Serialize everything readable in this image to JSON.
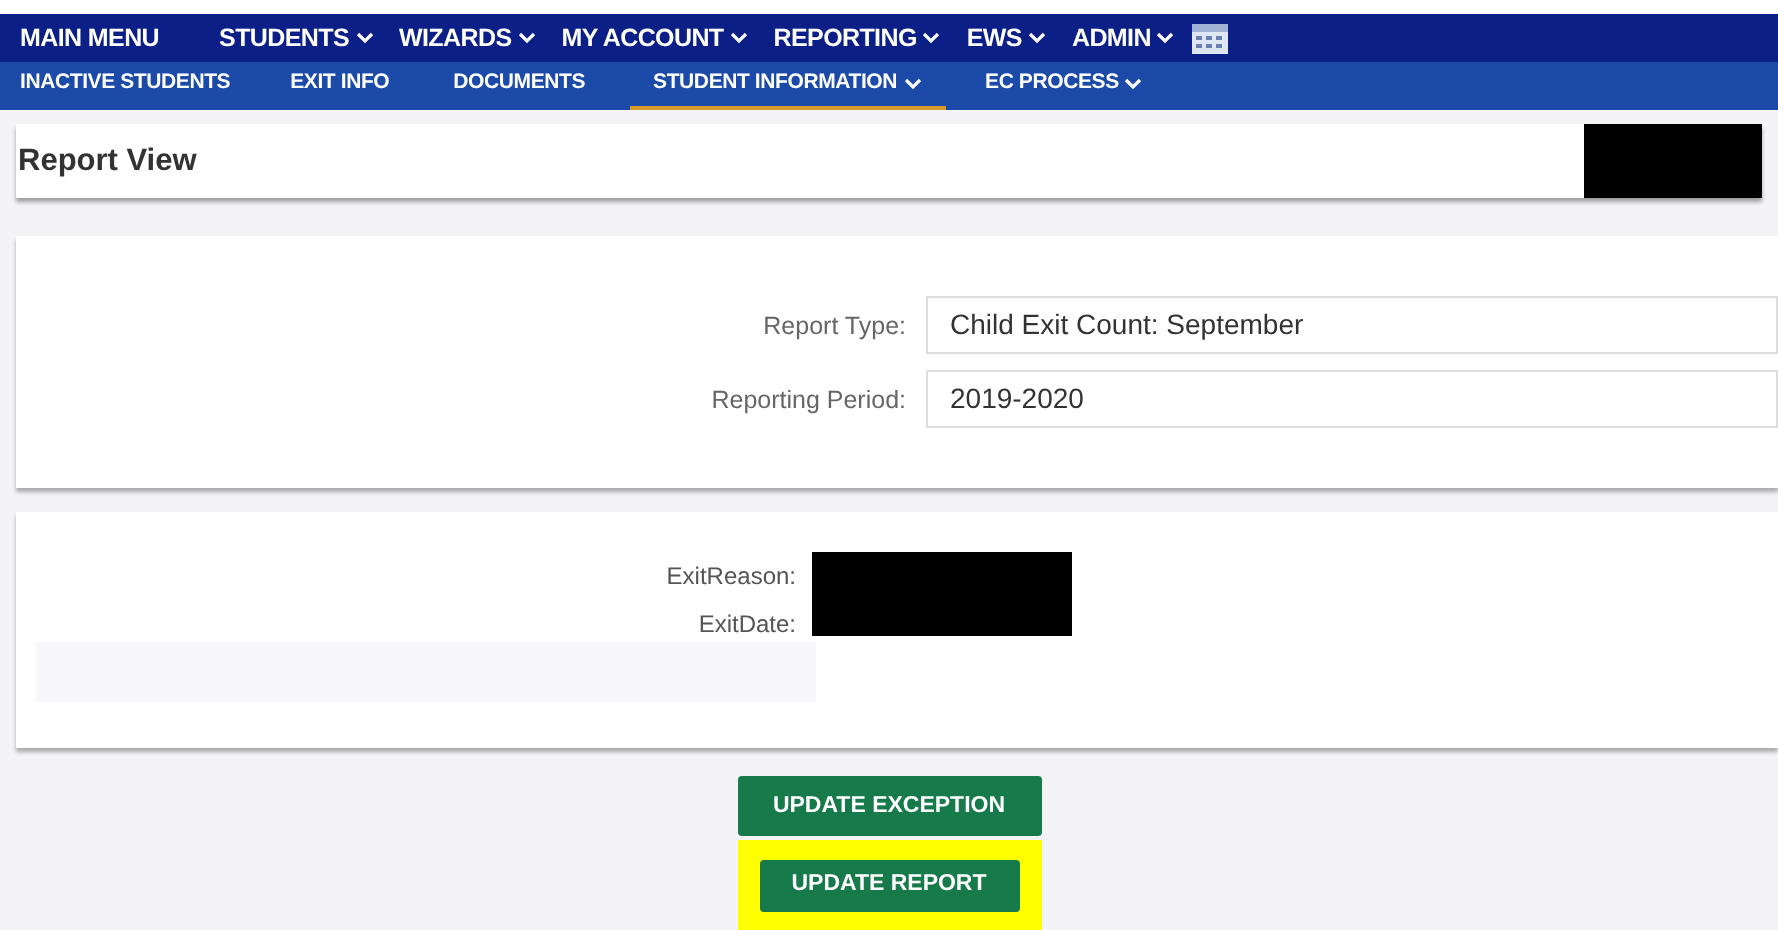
{
  "main_menu": [
    {
      "label": "MAIN MENU",
      "dropdown": false
    },
    {
      "label": "STUDENTS",
      "dropdown": true
    },
    {
      "label": "WIZARDS",
      "dropdown": true
    },
    {
      "label": "MY ACCOUNT",
      "dropdown": true
    },
    {
      "label": "REPORTING",
      "dropdown": true
    },
    {
      "label": "EWS",
      "dropdown": true
    },
    {
      "label": "ADMIN",
      "dropdown": true
    }
  ],
  "sub_menu": [
    {
      "label": "INACTIVE STUDENTS",
      "dropdown": false,
      "selected": false
    },
    {
      "label": "EXIT INFO",
      "dropdown": false,
      "selected": false
    },
    {
      "label": "DOCUMENTS",
      "dropdown": false,
      "selected": false
    },
    {
      "label": "STUDENT INFORMATION",
      "dropdown": true,
      "selected": true
    },
    {
      "label": "EC PROCESS",
      "dropdown": true,
      "selected": false
    }
  ],
  "page_title": "Report View",
  "form": [
    {
      "label": "Report Type:",
      "value": "Child Exit Count: September"
    },
    {
      "label": "Reporting Period:",
      "value": "2019-2020"
    }
  ],
  "details": [
    {
      "label": "ExitReason:"
    },
    {
      "label": "ExitDate:"
    }
  ],
  "buttons": [
    {
      "label": "UPDATE EXCEPTION",
      "highlighted": false
    },
    {
      "label": "UPDATE REPORT",
      "highlighted": true
    }
  ]
}
